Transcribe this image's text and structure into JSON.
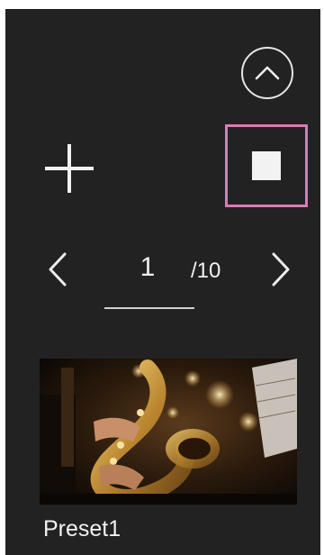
{
  "pager": {
    "current_page": "1",
    "total_pages": "/10"
  },
  "presets": [
    {
      "label": "Preset1",
      "thumbnail": "saxophone-player-photo"
    }
  ],
  "controls": {
    "collapse_icon": "chevron-up-circle-icon",
    "add_icon": "plus-icon",
    "stop_icon": "stop-square-icon",
    "prev_icon": "chevron-left-icon",
    "next_icon": "chevron-right-icon"
  },
  "colors": {
    "panel_background": "#222222",
    "highlight_frame": "#d87bb8",
    "foreground": "#f0f0f0"
  }
}
